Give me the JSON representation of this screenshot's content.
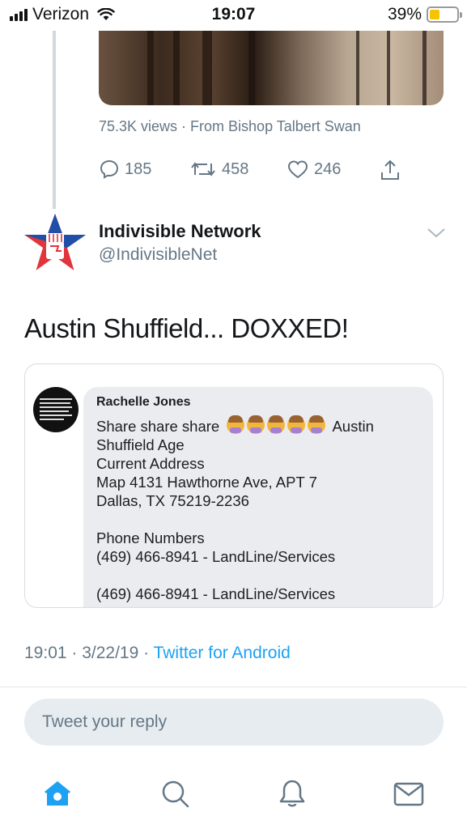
{
  "status_bar": {
    "carrier": "Verizon",
    "time": "19:07",
    "battery_percent": "39%",
    "battery_level": 0.39,
    "icons": [
      "signal-icon",
      "wifi-icon",
      "battery-icon"
    ]
  },
  "previous_tweet": {
    "views_text": "75.3K views · From Bishop Talbert Swan",
    "actions": {
      "reply_count": "185",
      "retweet_count": "458",
      "like_count": "246"
    }
  },
  "tweet": {
    "display_name": "Indivisible Network",
    "handle": "@IndivisibleNet",
    "text": "Austin Shuffield... DOXXED!",
    "timestamp": "19:01 · 3/22/19 · ",
    "source": "Twitter for Android"
  },
  "attached_image": {
    "author": "Rachelle Jones",
    "line1_start": "Share share share",
    "line1_end": "Austin",
    "line2": "Shuffield Age",
    "line3": "Current Address",
    "line4": "Map 4131 Hawthorne Ave, APT 7",
    "line5": "Dallas, TX 75219-2236",
    "line6": "Phone Numbers",
    "line7": "(469) 466-8941 - LandLine/Services",
    "line8": "(469) 466-8941 - LandLine/Services"
  },
  "reply": {
    "placeholder": "Tweet your reply"
  },
  "colors": {
    "accent": "#1da1f2",
    "muted": "#657786",
    "text": "#14171a",
    "logo_red": "#e2343b",
    "logo_blue": "#1f4fa8"
  },
  "tabbar": {
    "tabs": [
      "home-icon",
      "search-icon",
      "notifications-icon",
      "messages-icon"
    ]
  }
}
